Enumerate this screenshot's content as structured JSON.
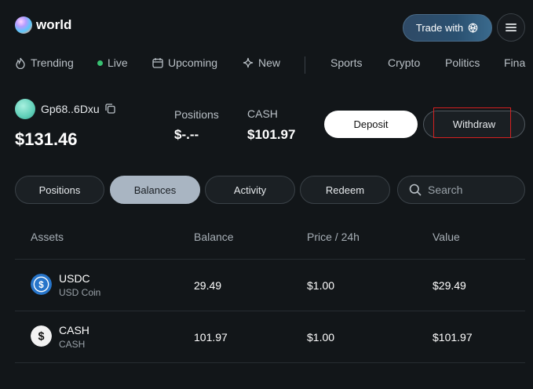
{
  "header": {
    "brand": "world",
    "trade_label": "Trade with",
    "trade_icon": "openai-icon",
    "menu_icon": "hamburger-icon"
  },
  "nav": {
    "items": [
      {
        "label": "Trending",
        "icon": "trending-icon"
      },
      {
        "label": "Live",
        "icon": "live-dot"
      },
      {
        "label": "Upcoming",
        "icon": "calendar-icon"
      },
      {
        "label": "New",
        "icon": "sparkle-icon"
      },
      {
        "label": "Sports"
      },
      {
        "label": "Crypto"
      },
      {
        "label": "Politics"
      },
      {
        "label": "Fina"
      }
    ]
  },
  "account": {
    "name": "Gp68..6Dxu",
    "balance": "$131.46",
    "positions_label": "Positions",
    "positions_value": "$-.--",
    "cash_label": "CASH",
    "cash_value": "$101.97",
    "deposit_label": "Deposit",
    "withdraw_label": "Withdraw"
  },
  "tabs": [
    {
      "label": "Positions",
      "active": false
    },
    {
      "label": "Balances",
      "active": true
    },
    {
      "label": "Activity",
      "active": false
    },
    {
      "label": "Redeem",
      "active": false
    }
  ],
  "search": {
    "placeholder": "Search"
  },
  "table": {
    "headers": [
      "Assets",
      "Balance",
      "Price / 24h",
      "Value"
    ],
    "rows": [
      {
        "name": "USDC",
        "sub": "USD Coin",
        "balance": "29.49",
        "price": "$1.00",
        "value": "$29.49",
        "icon": "usdc-icon"
      },
      {
        "name": "CASH",
        "sub": "CASH",
        "balance": "101.97",
        "price": "$1.00",
        "value": "$101.97",
        "icon": "cash-icon"
      }
    ]
  },
  "colors": {
    "background": "#121619",
    "active_tab": "#a9b5c2",
    "live": "#38c172",
    "usdc": "#2775ca",
    "highlight_box": "#d42020"
  }
}
